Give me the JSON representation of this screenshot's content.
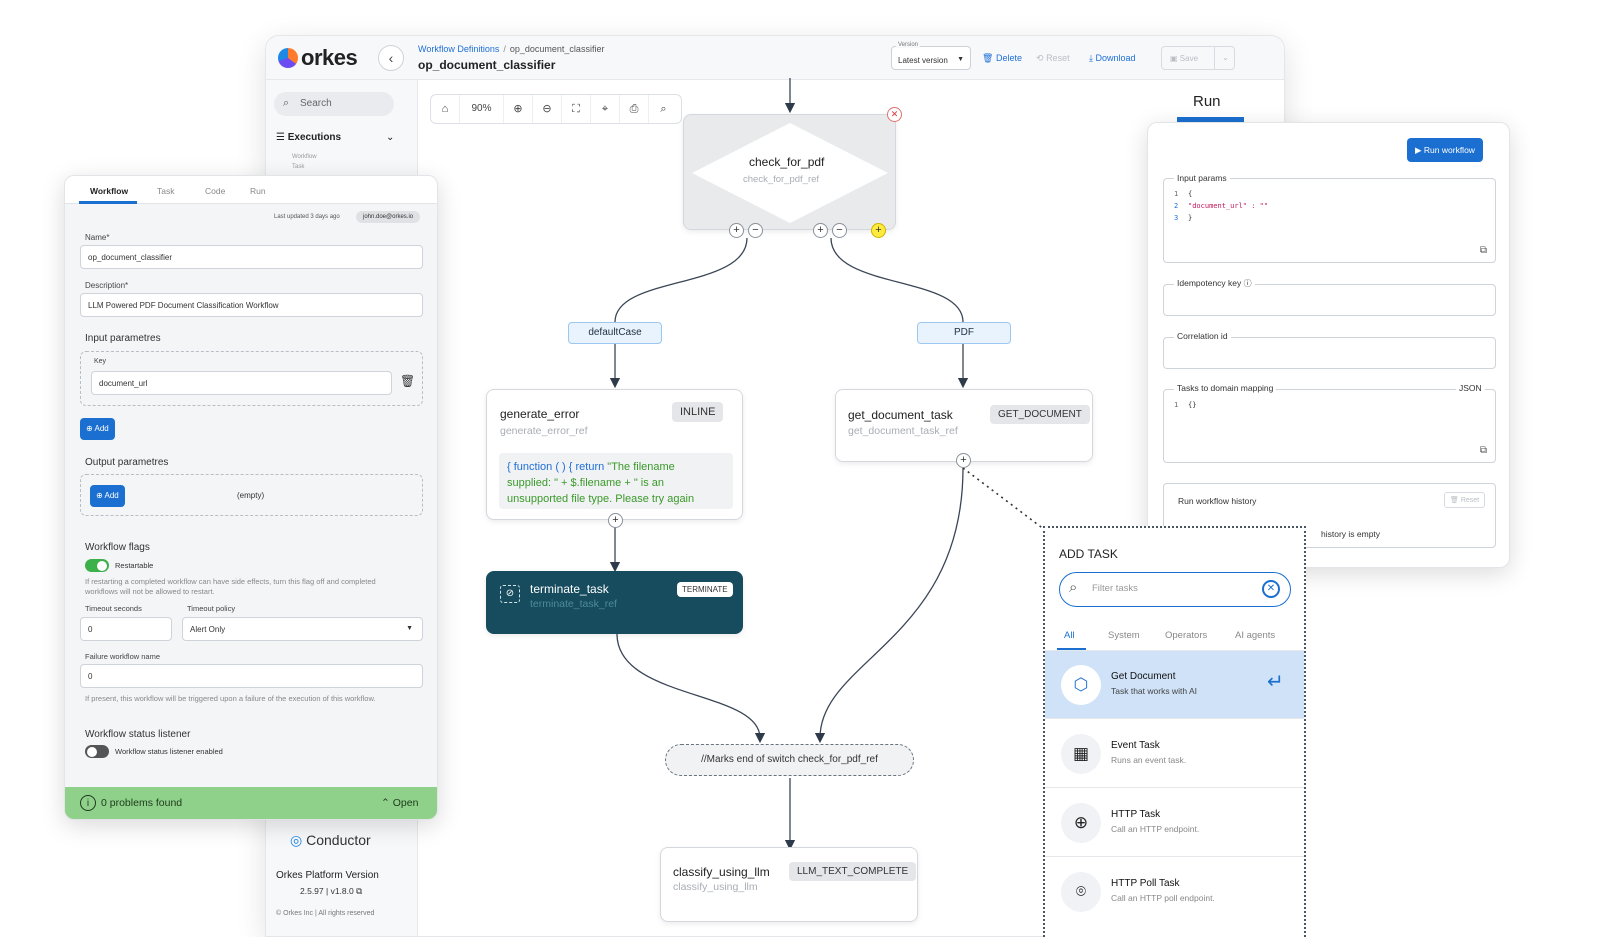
{
  "app": {
    "brand": "orkes",
    "breadcrumb_root": "Workflow Definitions",
    "breadcrumb_sep": "/",
    "breadcrumb_current": "op_document_classifier",
    "title": "op_document_classifier",
    "version_label": "Version",
    "version_value": "Latest version",
    "delete_label": "Delete",
    "reset_label": "Reset",
    "download_label": "Download",
    "save_label": "Save",
    "search_placeholder": "Search",
    "executions_label": "Executions",
    "nav_sub_workflow": "Workflow",
    "nav_sub_task": "Task",
    "zoom": "90%",
    "conductor_label": "Conductor",
    "platform_version_label": "Orkes Platform Version",
    "platform_version": "2.5.97 | v1.8.0",
    "copyright": "© Orkes Inc | All rights reserved"
  },
  "canvas": {
    "switch_node": {
      "name": "check_for_pdf",
      "ref": "check_for_pdf_ref"
    },
    "case_default": "defaultCase",
    "case_pdf": "PDF",
    "generate_error": {
      "name": "generate_error",
      "ref": "generate_error_ref",
      "type": "INLINE",
      "code_1": "{ ",
      "code_kw1": "function",
      "code_2": " ( ) { ",
      "code_kw2": "return",
      "code_3": " \"The filename",
      "code_line2": "supplied: \" + $.filename + \" is an",
      "code_line3": "unsupported file type. Please try again"
    },
    "get_document": {
      "name": "get_document_task",
      "ref": "get_document_task_ref",
      "type": "GET_DOCUMENT"
    },
    "terminate": {
      "name": "terminate_task",
      "ref": "terminate_task_ref",
      "type": "TERMINATE"
    },
    "join_label": "//Marks end of switch check_for_pdf_ref",
    "classify": {
      "name": "classify_using_llm",
      "ref": "classify_using_llm",
      "type": "LLM_TEXT_COMPLETE"
    }
  },
  "wf_panel": {
    "tabs": [
      "Workflow",
      "Task",
      "Code",
      "Run"
    ],
    "last_updated": "Last updated 3 days ago",
    "user": "john.doe@orkes.io",
    "name_label": "Name*",
    "name_value": "op_document_classifier",
    "desc_label": "Description*",
    "desc_value": "LLM Powered PDF Document Classification Workflow",
    "input_params_title": "Input parametres",
    "key_label": "Key",
    "key_value": "document_url",
    "add_label": "Add",
    "output_params_title": "Output parametres",
    "empty_label": "(empty)",
    "flags_title": "Workflow flags",
    "restartable_label": "Restartable",
    "restart_help_1": "If restarting a completed workflow can have side effects, turn this flag off and completed",
    "restart_help_2": "workflows will not be allowed to restart.",
    "timeout_seconds_label": "Timeout seconds",
    "timeout_seconds_value": "0",
    "timeout_policy_label": "Timeout policy",
    "timeout_policy_value": "Alert Only",
    "failure_label": "Failure workflow name",
    "failure_value": "0",
    "failure_help": "If present, this workflow will be triggered upon a failure of the execution of this workflow.",
    "listener_title": "Workflow status listener",
    "listener_label": "Workflow status listener enabled",
    "problems": "0 problems found",
    "open_label": "Open"
  },
  "run_panel": {
    "title": "Run",
    "run_button": "Run workflow",
    "input_params_label": "Input params",
    "code_ln1": "1",
    "code_ln2": "2",
    "code_ln3": "3",
    "code_l1": "{",
    "code_l2": "\"document_url\" : \"\"",
    "code_l3": "}",
    "idempotency_label": "Idempotency key",
    "correlation_label": "Correlation id",
    "domain_label": "Tasks to domain mapping",
    "json_label": "JSON",
    "domain_ln": "1",
    "domain_code": "{}",
    "history_label": "Run workflow history",
    "history_reset": "Reset",
    "history_empty": "history is empty"
  },
  "add_task": {
    "title": "ADD TASK",
    "filter_placeholder": "Filter tasks",
    "tabs": [
      "All",
      "System",
      "Operators",
      "AI agents"
    ],
    "tasks": [
      {
        "name": "Get Document",
        "desc": "Task that works with AI",
        "icon": "document-hex-icon"
      },
      {
        "name": "Event Task",
        "desc": "Runs an event task.",
        "icon": "calendar-icon"
      },
      {
        "name": "HTTP Task",
        "desc": "Call an HTTP endpoint.",
        "icon": "globe-icon"
      },
      {
        "name": "HTTP Poll Task",
        "desc": "Call an HTTP poll endpoint.",
        "icon": "poll-icon"
      }
    ]
  },
  "colors": {
    "accent": "#1b6fd0",
    "terminate_bg": "#164c5e",
    "success_bar": "#8fd08a",
    "toggle_on": "#3cb04a"
  }
}
